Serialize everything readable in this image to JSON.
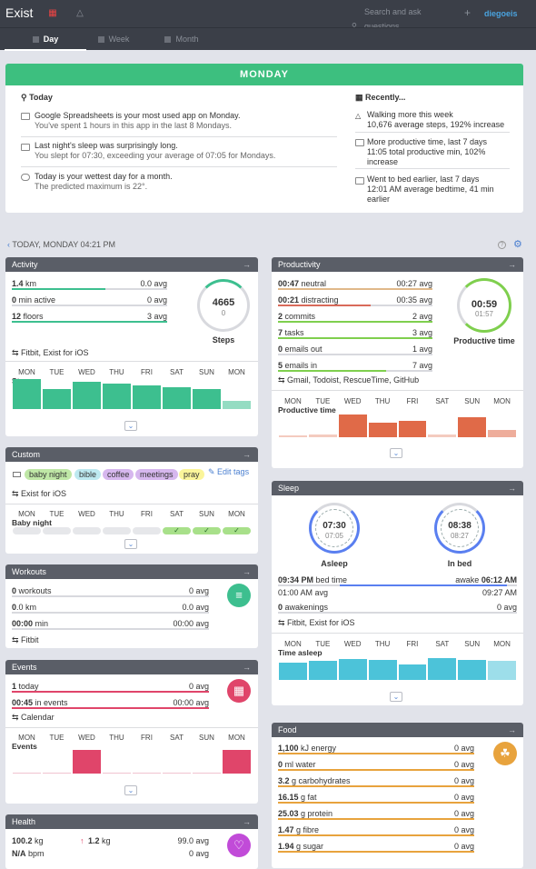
{
  "app": {
    "logo": "Exist",
    "search_line1": "Search and ask",
    "search_line2": "questions",
    "user": "diegoeis",
    "accent": "#3dbf7f"
  },
  "tabs": [
    {
      "label": "Day"
    },
    {
      "label": "Week"
    },
    {
      "label": "Month"
    }
  ],
  "banner": {
    "day": "MONDAY",
    "today_title": "Today",
    "recent_title": "Recently...",
    "today": [
      {
        "line1": "Google Spreadsheets is your most used app on Monday.",
        "line2": "You've spent 1 hours in this app in the last 8 Mondays."
      },
      {
        "line1": "Last night's sleep was surprisingly long.",
        "line2": "You slept for 07:30, exceeding your average of 07:05 for Mondays."
      },
      {
        "line1": "Today is your wettest day for a month.",
        "line2": "The predicted maximum is 22°."
      }
    ],
    "recent": [
      {
        "line1": "Walking more this week",
        "line2": "10,676 average steps, 192% increase"
      },
      {
        "line1": "More productive time, last 7 days",
        "line2": "11:05 total productive min, 102%",
        "line3": "increase"
      },
      {
        "line1": "Went to bed earlier, last 7 days",
        "line2": "12:01 AM average bedtime, 41 min",
        "line3": "earlier"
      }
    ]
  },
  "crumb": "TODAY, MONDAY 04:21 PM",
  "days": [
    "MON",
    "TUE",
    "WED",
    "THU",
    "FRI",
    "SAT",
    "SUN",
    "MON"
  ],
  "activity": {
    "title": "Activity",
    "rows": [
      {
        "value": "1.4",
        "unit": " km",
        "avg": "0.0 avg",
        "fill": 0.6
      },
      {
        "value": "0",
        "unit": " min active",
        "avg": "0 avg",
        "fill": 0
      },
      {
        "value": "12",
        "unit": " floors",
        "avg": "3 avg",
        "fill": 1.0
      }
    ],
    "ring_value": "4665",
    "ring_sub": "0",
    "ring_label": "Steps",
    "source": "Fitbit, Exist for iOS",
    "chart_label": "Steps",
    "chart_values": [
      0.9,
      0.6,
      0.8,
      0.75,
      0.7,
      0.65,
      0.6,
      0.25
    ]
  },
  "custom": {
    "title": "Custom",
    "tags": [
      "baby night",
      "bible",
      "coffee",
      "meetings",
      "pray"
    ],
    "edit": "Edit tags",
    "source": "Exist for iOS",
    "chart_label": "Baby night"
  },
  "workouts": {
    "title": "Workouts",
    "rows": [
      {
        "value": "0",
        "unit": " workouts",
        "avg": "0 avg"
      },
      {
        "value": "0",
        "unit": ".0 km",
        "avg": "0.0 avg"
      },
      {
        "value": "00:00",
        "unit": " min",
        "avg": "00:00 avg"
      }
    ],
    "source": "Fitbit"
  },
  "events": {
    "title": "Events",
    "rows": [
      {
        "value": "1",
        "unit": " today",
        "avg": "0 avg"
      },
      {
        "value": "00:45",
        "unit": " in events",
        "avg": "00:00 avg"
      }
    ],
    "source": "Calendar",
    "chart_label": "Events"
  },
  "health": {
    "title": "Health",
    "row1_value": "100.2",
    "row1_unit": " kg",
    "row1_delta": "1.2",
    "row1_delta_unit": " kg",
    "row1_avg": "99.0 avg",
    "row2_value": "N/A",
    "row2_unit": " bpm",
    "row2_avg": "0 avg"
  },
  "productivity": {
    "title": "Productivity",
    "rows": [
      {
        "value": "00:47",
        "unit": " neutral",
        "avg": "00:27 avg",
        "color": "#e0b98a",
        "fill": 1.0
      },
      {
        "value": "00:21",
        "unit": " distracting",
        "avg": "00:35 avg",
        "color": "#d96a5a",
        "fill": 0.6
      },
      {
        "value": "2",
        "unit": " commits",
        "avg": "2 avg",
        "color": "#7fcf4e",
        "fill": 1.0
      },
      {
        "value": "7",
        "unit": " tasks",
        "avg": "3 avg",
        "color": "#7fcf4e",
        "fill": 1.0
      },
      {
        "value": "0",
        "unit": " emails out",
        "avg": "1 avg",
        "color": "#7fcf4e",
        "fill": 0
      },
      {
        "value": "5",
        "unit": " emails in",
        "avg": "7 avg",
        "color": "#7fcf4e",
        "fill": 0.7
      }
    ],
    "ring_value": "00:59",
    "ring_sub": "01:57",
    "ring_label": "Productive time",
    "source": "Gmail, Todoist, RescueTime, GitHub",
    "chart_label": "Productive time",
    "chart_values": [
      0.05,
      0.1,
      0.95,
      0.6,
      0.7,
      0.1,
      0.85,
      0.3
    ]
  },
  "sleep": {
    "title": "Sleep",
    "asleep": "07:30",
    "asleep_avg": "07:05",
    "asleep_label": "Asleep",
    "inbed": "08:38",
    "inbed_avg": "08:27",
    "inbed_label": "In bed",
    "bed_value": "09:34 PM",
    "bed_label": " bed time",
    "awake_label": "awake ",
    "awake_value": "06:12 AM",
    "left_avg": "01:00 AM avg",
    "right_avg": "09:27 AM",
    "awakenings_value": "0",
    "awakenings_label": " awakenings",
    "awakenings_avg": "0 avg",
    "source": "Fitbit, Exist for iOS",
    "chart_label": "Time asleep",
    "chart_values": [
      0.72,
      0.78,
      0.85,
      0.82,
      0.62,
      0.88,
      0.82,
      0.78
    ]
  },
  "food": {
    "title": "Food",
    "rows": [
      {
        "value": "1,100",
        "unit": " kJ energy",
        "avg": "0 avg"
      },
      {
        "value": "0",
        "unit": " ml water",
        "avg": "0 avg"
      },
      {
        "value": "3.2",
        "unit": " g carbohydrates",
        "avg": "0 avg"
      },
      {
        "value": "16.15",
        "unit": " g fat",
        "avg": "0 avg"
      },
      {
        "value": "25.03",
        "unit": " g protein",
        "avg": "0 avg"
      },
      {
        "value": "1.47",
        "unit": " g fibre",
        "avg": "0 avg"
      },
      {
        "value": "1.94",
        "unit": " g sugar",
        "avg": "0 avg"
      }
    ]
  }
}
